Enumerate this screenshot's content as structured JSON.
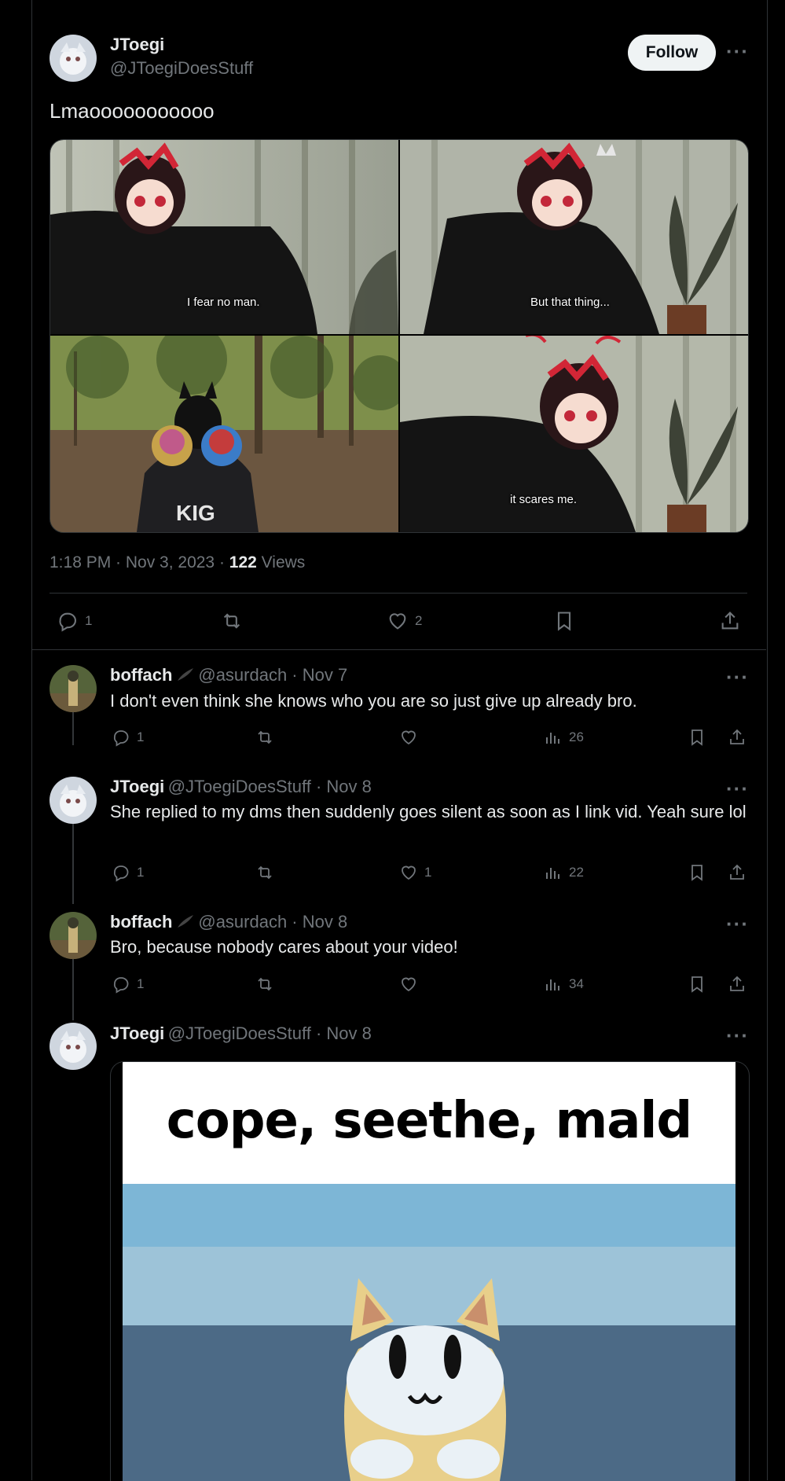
{
  "post": {
    "author_name": "JToegi",
    "author_handle": "@JToegiDoesStuff",
    "follow_label": "Follow",
    "more_label": "···",
    "text": "Lmaooooooooooo",
    "captions": [
      "I fear no man.",
      "But that thing...",
      "it scares me."
    ],
    "timestamp": "1:18 PM · Nov 3, 2023 · ",
    "views_count": "122",
    "views_label": " Views",
    "actions": {
      "replies": "1",
      "retweets": "",
      "likes": "2"
    }
  },
  "replies": [
    {
      "name": "boffach",
      "handle": "@asurdach · Nov 7",
      "text": "I don't even think she knows who you are so just give up already bro.",
      "replies": "1",
      "likes": "",
      "views": "26"
    },
    {
      "name": "JToegi",
      "handle": "@JToegiDoesStuff · Nov 8",
      "text": "She replied to my dms then suddenly goes silent as soon as I link vid. Yeah sure lol",
      "replies": "1",
      "likes": "1",
      "views": "22"
    },
    {
      "name": "boffach",
      "handle": "@asurdach · Nov 8",
      "text": "Bro, because nobody cares about your video!",
      "replies": "1",
      "likes": "",
      "views": "34"
    },
    {
      "name": "JToegi",
      "handle": "@JToegiDoesStuff · Nov 8",
      "meme_text": "cope, seethe, mald"
    }
  ],
  "colors": {
    "background": "#000000",
    "text": "#e7e9ea",
    "muted": "#71767b",
    "border": "#2f3336"
  }
}
